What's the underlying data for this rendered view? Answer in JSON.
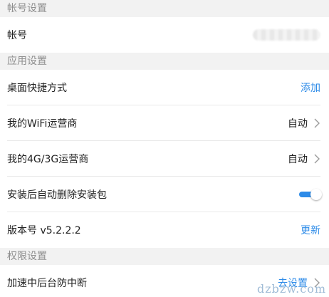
{
  "sections": {
    "account": {
      "header": "帐号设置",
      "account_label": "帐号"
    },
    "app": {
      "header": "应用设置",
      "desktop_shortcut": {
        "label": "桌面快捷方式",
        "action": "添加"
      },
      "wifi_carrier": {
        "label": "我的WiFi运营商",
        "value": "自动"
      },
      "mobile_carrier": {
        "label": "我的4G/3G运营商",
        "value": "自动"
      },
      "auto_delete": {
        "label": "安装后自动删除安装包",
        "enabled": true
      },
      "version": {
        "label": "版本号 v5.2.2.2",
        "action": "更新"
      }
    },
    "permissions": {
      "header": "权限设置",
      "anti_interrupt": {
        "label": "加速中后台防中断",
        "action": "去设置"
      }
    }
  },
  "watermark": "dzbzw.com",
  "colors": {
    "accent": "#2d8be8",
    "background": "#f2f2f2",
    "header_text": "#8e8e8e"
  }
}
